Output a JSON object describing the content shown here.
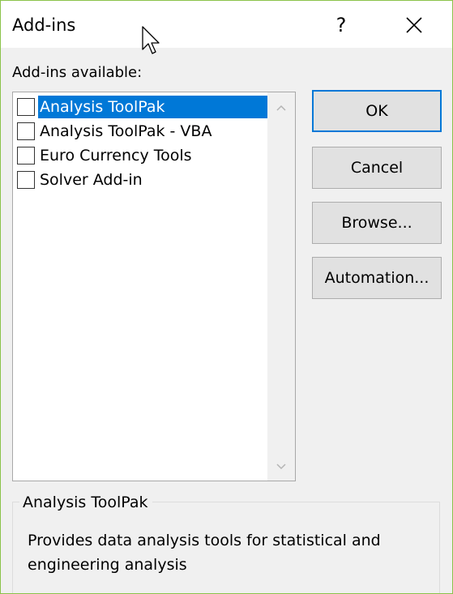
{
  "dialog": {
    "title": "Add-ins",
    "help_label": "?",
    "close_icon": "close-icon",
    "border_color": "#8bc34a"
  },
  "addins": {
    "label": "Add-ins available:",
    "items": [
      {
        "label": "Analysis ToolPak",
        "checked": false,
        "selected": true
      },
      {
        "label": "Analysis ToolPak - VBA",
        "checked": false,
        "selected": false
      },
      {
        "label": "Euro Currency Tools",
        "checked": false,
        "selected": false
      },
      {
        "label": "Solver Add-in",
        "checked": false,
        "selected": false
      }
    ],
    "selection_color": "#0078d7"
  },
  "buttons": {
    "ok": "OK",
    "cancel": "Cancel",
    "browse": "Browse...",
    "automation": "Automation..."
  },
  "description": {
    "title": "Analysis ToolPak",
    "text": "Provides data analysis tools for statistical and engineering analysis"
  }
}
